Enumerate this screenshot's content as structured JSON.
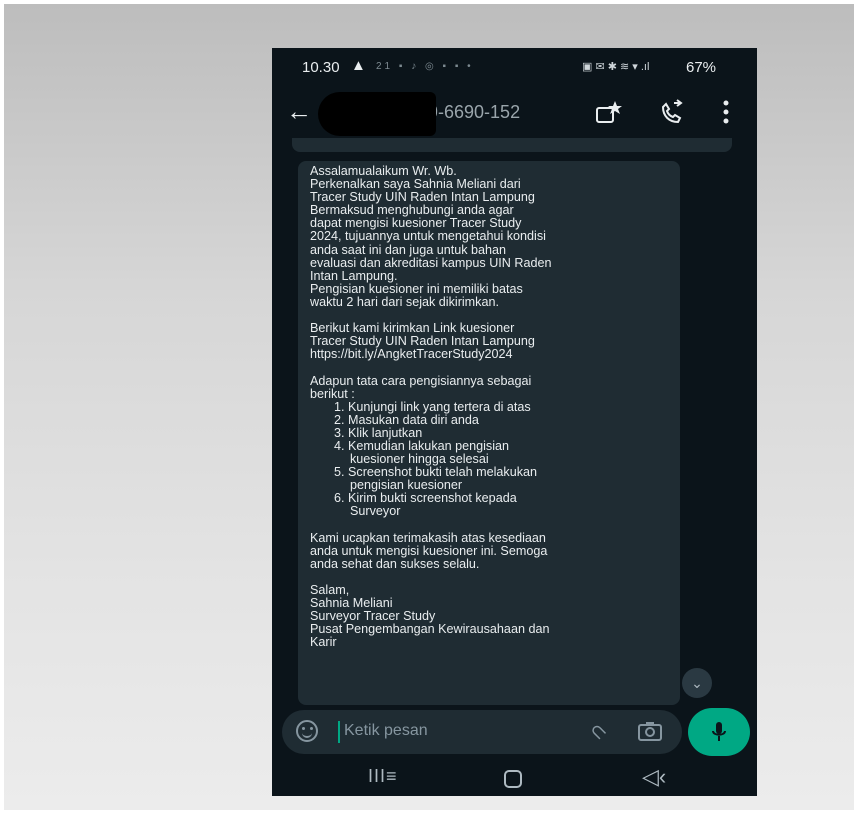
{
  "status_bar": {
    "time": "10.30",
    "warning_icon": "warning-icon",
    "notification_apps": "21",
    "battery": "67%"
  },
  "header": {
    "contact_name": "9-6690-152",
    "icons": [
      "back-arrow-icon",
      "video-call-icon",
      "voice-call-icon",
      "menu-dots-icon"
    ]
  },
  "message": {
    "lines": [
      "Assalamualaikum Wr. Wb.",
      "Perkenalkan saya Sahnia Meliani dari",
      "Tracer Study UIN Raden Intan Lampung",
      "Bermaksud menghubungi anda agar",
      "dapat mengisi kuesioner Tracer Study",
      "2024, tujuannya untuk mengetahui kondisi",
      "anda saat ini dan juga untuk bahan",
      "evaluasi dan akreditasi kampus UIN Raden",
      "Intan Lampung.",
      "Pengisian kuesioner ini memiliki batas",
      "waktu 2 hari dari sejak dikirimkan."
    ],
    "link_lines": [
      "Berikut kami kirimkan Link kuesioner",
      "Tracer Study UIN Raden Intan Lampung",
      "https://bit.ly/AngketTracerStudy2024"
    ],
    "steps_intro": [
      "Adapun tata cara pengisiannya sebagai",
      "berikut :"
    ],
    "steps": [
      "1. Kunjungi link yang tertera di atas",
      "2. Masukan data diri anda",
      "3. Klik lanjutkan",
      "4. Kemudian lakukan pengisian",
      "kuesioner hingga selesai",
      "5. Screenshot bukti telah melakukan",
      "pengisian kuesioner",
      "6. Kirim bukti screenshot kepada",
      "Surveyor"
    ],
    "closing": [
      "Kami ucapkan terimakasih atas kesediaan",
      "anda untuk mengisi kuesioner ini. Semoga",
      "anda sehat dan sukses selalu."
    ],
    "signature": [
      "Salam,",
      "Sahnia Meliani",
      "Surveyor Tracer Study",
      "Pusat Pengembangan Kewirausahaan dan",
      "Karir"
    ]
  },
  "input": {
    "placeholder": "Ketik pesan"
  },
  "colors": {
    "background": "#0b141a",
    "bubble": "#1f2c33",
    "accent": "#00a884",
    "text": "#e9edef",
    "muted": "#8696a0"
  }
}
